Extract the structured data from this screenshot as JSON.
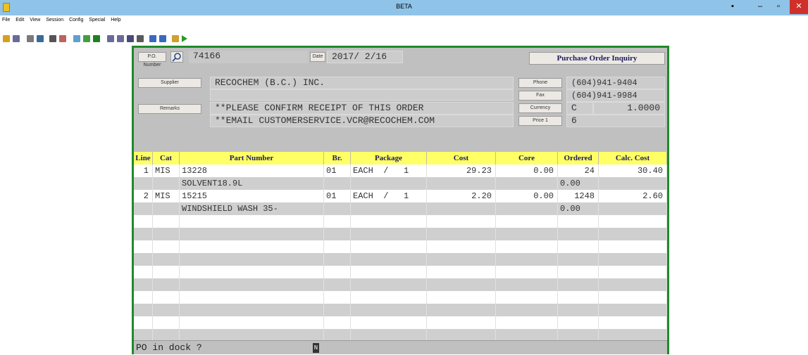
{
  "window": {
    "title": "BETA"
  },
  "menu": [
    "File",
    "Edit",
    "View",
    "Session",
    "Config",
    "Special",
    "Help"
  ],
  "header": {
    "po_label": "P.O. Number",
    "po_number": "74166",
    "date_label": "Date",
    "date_value": "2017/ 2/16",
    "screen_title": "Purchase Order Inquiry"
  },
  "supplier": {
    "label": "Supplier",
    "name": "RECOCHEM (B.C.) INC."
  },
  "remarks": {
    "label": "Remarks",
    "line1": "**PLEASE CONFIRM RECEIPT OF THIS ORDER",
    "line2": "**EMAIL CUSTOMERSERVICE.VCR@RECOCHEM.COM"
  },
  "contact": {
    "phone_label": "Phone",
    "phone": "(604)941-9404",
    "fax_label": "Fax",
    "fax": "(604)941-9984",
    "currency_label": "Currency",
    "currency_code": "C",
    "currency_rate": "1.0000",
    "price_label": "Price 1",
    "price_value": "6"
  },
  "table": {
    "columns": [
      "Line",
      "Cat",
      "Part Number",
      "Br.",
      "Package",
      "Cost",
      "Core",
      "Ordered",
      "Calc. Cost"
    ],
    "rows": [
      {
        "line": "1",
        "cat": "MIS",
        "part": "13228",
        "br": "01",
        "pkg": "EACH  /   1",
        "cost": "29.23",
        "core": "0.00",
        "ordered": "24",
        "calc": "30.40"
      },
      {
        "line": "",
        "cat": "",
        "part": "SOLVENT18.9L",
        "br": "",
        "pkg": "",
        "cost": "",
        "core": "",
        "ordered": "0.00",
        "calc": ""
      },
      {
        "line": "2",
        "cat": "MIS",
        "part": "15215",
        "br": "01",
        "pkg": "EACH  /   1",
        "cost": "2.20",
        "core": "0.00",
        "ordered": "1248",
        "calc": "2.60"
      },
      {
        "line": "",
        "cat": "",
        "part": "WINDSHIELD WASH 35-",
        "br": "",
        "pkg": "",
        "cost": "",
        "core": "",
        "ordered": "0.00",
        "calc": ""
      }
    ]
  },
  "status": {
    "prompt": "PO in dock ?",
    "cursor": "N"
  },
  "colors": {
    "titlebar": "#8fc3e8",
    "panel_border": "#1f8a2a",
    "grid_header": "#ffff66",
    "panel": "#c0c0c0"
  },
  "icons": [
    "app-icon",
    "minimize-icon",
    "maximize-icon",
    "close-icon",
    "search-icon"
  ]
}
